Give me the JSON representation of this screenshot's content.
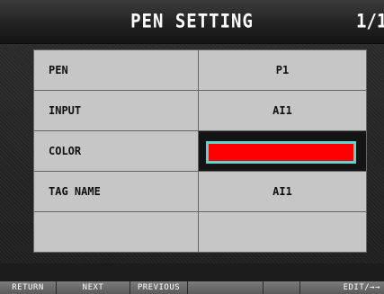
{
  "header": {
    "title": "PEN SETTING",
    "page_indicator": "1/1"
  },
  "rows": [
    {
      "label": "PEN",
      "value": "P1"
    },
    {
      "label": "INPUT",
      "value": "AI1"
    },
    {
      "label": "COLOR",
      "value_color": "#ff0000"
    },
    {
      "label": "TAG NAME",
      "value": "AI1"
    },
    {
      "label": "",
      "value": ""
    }
  ],
  "softkeys": [
    "RETURN",
    "NEXT",
    "PREVIOUS",
    "",
    "",
    "EDIT/→→"
  ],
  "colors": {
    "selection_border": "#5fd6cc",
    "pen_color": "#ff0000"
  }
}
